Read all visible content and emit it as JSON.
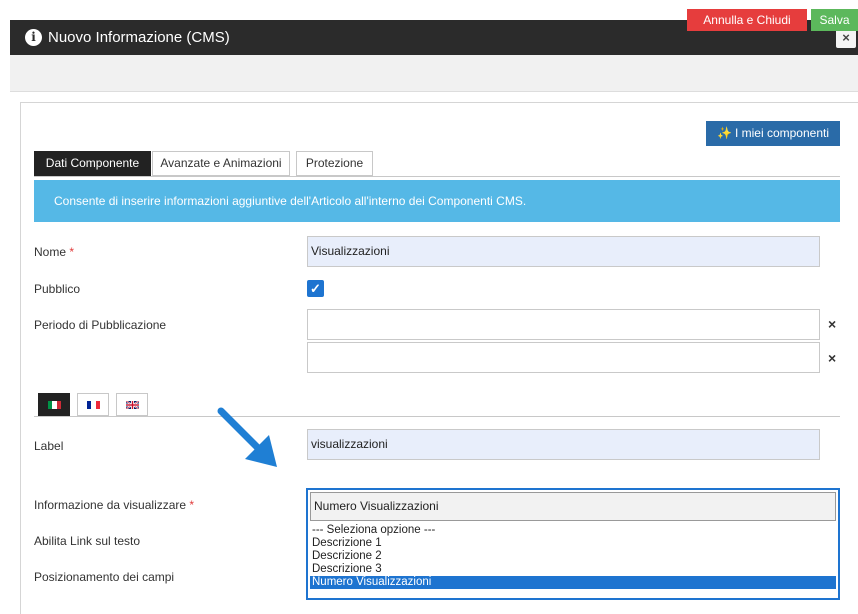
{
  "dialog": {
    "title": "Nuovo Informazione (CMS)",
    "close_symbol": "×"
  },
  "toolbar": {
    "annulla_label": "Annulla e Chiudi",
    "salva_label": "Salva"
  },
  "components_button": {
    "label": "I miei componenti",
    "icon": "magic-wand-icon"
  },
  "tabs": [
    {
      "label": "Dati Componente",
      "active": true
    },
    {
      "label": "Avanzate e Animazioni",
      "active": false
    },
    {
      "label": "Protezione",
      "active": false
    }
  ],
  "banner": {
    "text": "Consente di inserire informazioni aggiuntive dell'Articolo all'interno dei Componenti CMS.",
    "color": "#55b8e6"
  },
  "form": {
    "required_mark": "*",
    "clear_symbol": "×",
    "nome": {
      "label": "Nome",
      "value": "Visualizzazioni"
    },
    "pubblico": {
      "label": "Pubblico",
      "checked": true,
      "check_symbol": "✓"
    },
    "periodo": {
      "label": "Periodo di Pubblicazione",
      "from": "",
      "to": ""
    },
    "languages": [
      {
        "name": "italian-flag",
        "active": true
      },
      {
        "name": "french-flag",
        "active": false
      },
      {
        "name": "english-flag",
        "active": false
      }
    ],
    "label_field": {
      "label": "Label",
      "value": "visualizzazioni"
    },
    "informazione": {
      "label": "Informazione da visualizzare",
      "value": "Numero Visualizzazioni",
      "options": [
        "--- Seleziona opzione ---",
        "Descrizione 1",
        "Descrizione 2",
        "Descrizione 3",
        "Numero Visualizzazioni"
      ],
      "selected_index": 4
    },
    "abilita_link": {
      "label": "Abilita Link sul testo"
    },
    "posizionamento": {
      "label": "Posizionamento dei campi"
    }
  },
  "colors": {
    "accent": "#1e74d0",
    "danger": "#e63d3d",
    "success": "#5cb85c",
    "primary_button": "#2a6ba8",
    "titlebar": "#2b2b2b"
  }
}
